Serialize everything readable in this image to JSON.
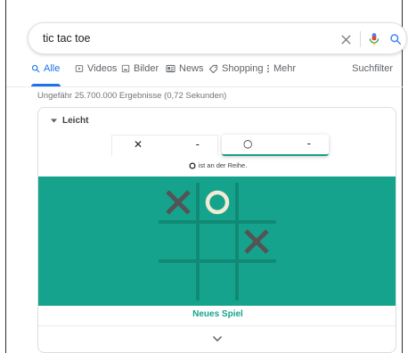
{
  "search": {
    "query": "tic tac toe"
  },
  "tabs": [
    {
      "label": "Alle",
      "icon": "search-icon",
      "active": true
    },
    {
      "label": "Videos",
      "icon": "video-icon"
    },
    {
      "label": "Bilder",
      "icon": "image-icon"
    },
    {
      "label": "News",
      "icon": "news-icon"
    },
    {
      "label": "Shopping",
      "icon": "tag-icon"
    },
    {
      "label": "Mehr",
      "icon": "more-vertical-icon"
    }
  ],
  "search_tools": "Suchfilter",
  "results_stats": "Ungefähr 25.700.000 Ergebnisse (0,72 Sekunden)",
  "game": {
    "difficulty": "Leicht",
    "players": [
      {
        "symbol": "✕",
        "score": "-"
      },
      {
        "symbol": "○",
        "score": "-"
      }
    ],
    "turn_text": "ist an der Reihe.",
    "board": [
      "X",
      "O",
      "",
      "",
      "",
      "X",
      "",
      "",
      ""
    ],
    "new_game": "Neues Spiel",
    "colors": {
      "board_bg": "#16a38d",
      "line": "#108a75",
      "x_mark": "#545454",
      "o_mark": "#f2ebd3"
    }
  }
}
